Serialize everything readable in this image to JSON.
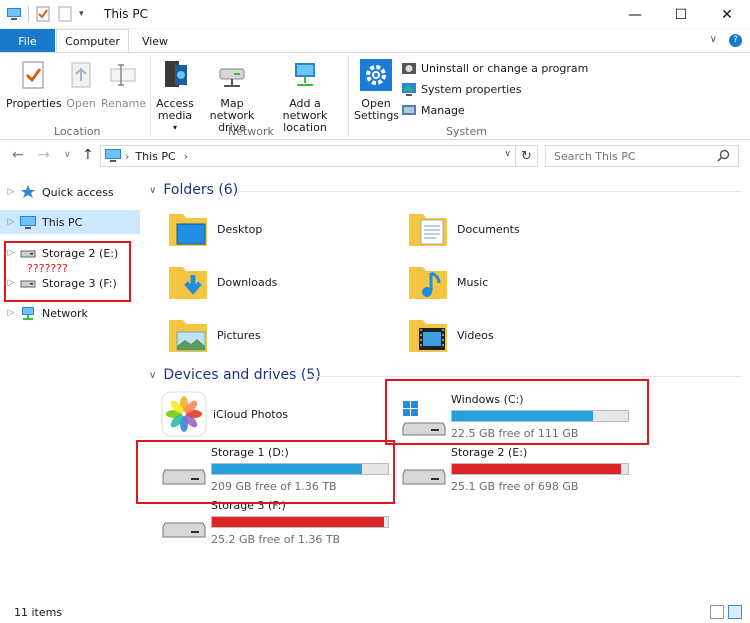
{
  "window": {
    "title": "This PC"
  },
  "tabs": {
    "file": "File",
    "computer": "Computer",
    "view": "View"
  },
  "ribbon": {
    "location": {
      "label": "Location",
      "properties": "Properties",
      "open": "Open",
      "rename": "Rename"
    },
    "network": {
      "label": "Network",
      "access_media": "Access media",
      "map_network_drive": "Map network drive",
      "add_network_location": "Add a network location"
    },
    "system": {
      "label": "System",
      "open_settings": "Open Settings",
      "uninstall": "Uninstall or change a program",
      "system_properties": "System properties",
      "manage": "Manage"
    }
  },
  "address": {
    "path": "This PC",
    "search_placeholder": "Search This PC"
  },
  "nav": {
    "items": [
      {
        "label": "Quick access"
      },
      {
        "label": "This PC"
      },
      {
        "label": "Storage 2 (E:)"
      },
      {
        "label": "Storage 3 (F:)"
      },
      {
        "label": "Network"
      }
    ],
    "annotation": "???????"
  },
  "folders": {
    "header": "Folders (6)",
    "items": [
      {
        "label": "Desktop"
      },
      {
        "label": "Documents"
      },
      {
        "label": "Downloads"
      },
      {
        "label": "Music"
      },
      {
        "label": "Pictures"
      },
      {
        "label": "Videos"
      }
    ]
  },
  "devices": {
    "header": "Devices and drives (5)",
    "icloud": "iCloud Photos",
    "drives": [
      {
        "name": "Windows (C:)",
        "free": "22.5 GB free of 111 GB",
        "used_fraction": 0.8,
        "color": "#26a0da"
      },
      {
        "name": "Storage 1 (D:)",
        "free": "209 GB free of 1.36 TB",
        "used_fraction": 0.85,
        "color": "#26a0da"
      },
      {
        "name": "Storage 2 (E:)",
        "free": "25.1 GB free of 698 GB",
        "used_fraction": 0.96,
        "color": "#da2626"
      },
      {
        "name": "Storage 3 (F:)",
        "free": "25.2 GB free of 1.36 TB",
        "used_fraction": 0.98,
        "color": "#da2626"
      }
    ]
  },
  "status": {
    "item_count": "11 items"
  },
  "icons": {
    "window": "computer-icon",
    "search": "search-icon",
    "refresh": "refresh-icon"
  }
}
